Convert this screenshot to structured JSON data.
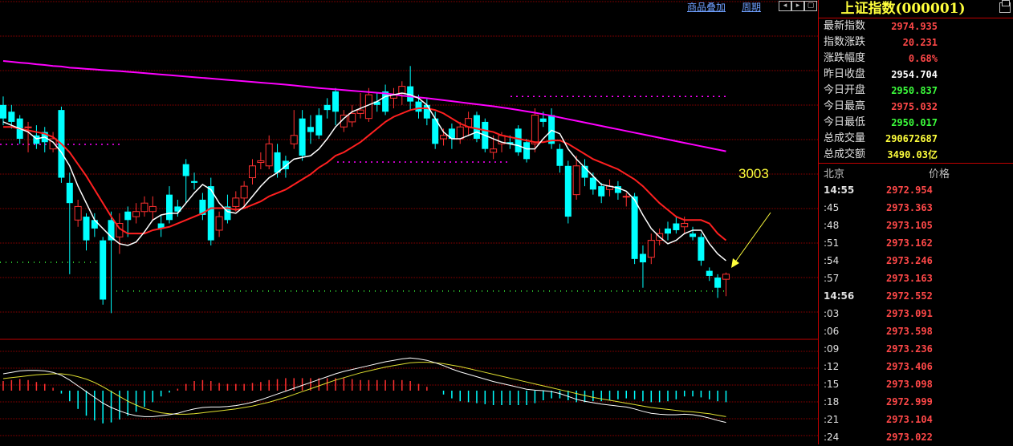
{
  "toolbar": {
    "overlay_label": "商品叠加",
    "period_label": "周期"
  },
  "annotation": {
    "text": "3003",
    "color": "#ffff3c"
  },
  "colors": {
    "up": "#ff3030",
    "down": "#00ffff",
    "ma5": "#ffffff",
    "ma10": "#ff2020",
    "ma60": "#ff00ff",
    "grid": "#8b0000",
    "arrow": "#ffff3c"
  },
  "panel": {
    "title": "上证指数(000001)",
    "stats": [
      {
        "label": "最新指数",
        "value": "2974.935",
        "color": "#ff4848"
      },
      {
        "label": "指数涨跌",
        "value": "20.231",
        "color": "#ff4848"
      },
      {
        "label": "涨跌幅度",
        "value": "0.68%",
        "color": "#ff4848"
      },
      {
        "label": "昨日收盘",
        "value": "2954.704",
        "color": "#ffffff"
      },
      {
        "label": "今日开盘",
        "value": "2950.837",
        "color": "#3cff3c"
      },
      {
        "label": "今日最高",
        "value": "2975.032",
        "color": "#ff4848"
      },
      {
        "label": "今日最低",
        "value": "2950.017",
        "color": "#3cff3c"
      },
      {
        "label": "总成交量",
        "value": "290672687",
        "color": "#ffff3c"
      },
      {
        "label": "总成交额",
        "value": "3490.03亿",
        "color": "#ffff3c"
      }
    ],
    "ticks_header": {
      "left": "北京",
      "right": "价格"
    },
    "ticks": [
      {
        "time": "14:55",
        "price": "2972.954",
        "bold": true
      },
      {
        "time": ":45",
        "price": "2973.363"
      },
      {
        "time": ":48",
        "price": "2973.105"
      },
      {
        "time": ":51",
        "price": "2973.162"
      },
      {
        "time": ":54",
        "price": "2973.246"
      },
      {
        "time": ":57",
        "price": "2973.163"
      },
      {
        "time": "14:56",
        "price": "2972.552",
        "bold": true
      },
      {
        "time": ":03",
        "price": "2973.091"
      },
      {
        "time": ":06",
        "price": "2973.598"
      },
      {
        "time": ":09",
        "price": "2973.236"
      },
      {
        "time": ":12",
        "price": "2973.406"
      },
      {
        "time": ":15",
        "price": "2973.098"
      },
      {
        "time": ":18",
        "price": "2972.999"
      },
      {
        "time": ":21",
        "price": "2973.104"
      },
      {
        "time": ":24",
        "price": "2973.022"
      }
    ]
  },
  "chart_data": {
    "type": "candlestick",
    "price_ylim": [
      2860,
      3060
    ],
    "ref_levels": {
      "upper": 3003,
      "lower": 2888,
      "left_dotted": 2905
    },
    "candles": [
      [
        2998,
        2990,
        3003,
        2986
      ],
      [
        2994,
        2988,
        2998,
        2984
      ],
      [
        2990,
        2978,
        2992,
        2975
      ],
      [
        2985,
        2985,
        2988,
        2970
      ],
      [
        2980,
        2975,
        2986,
        2972
      ],
      [
        2982,
        2976,
        2985,
        2970
      ],
      [
        2972,
        2978,
        2982,
        2970
      ],
      [
        2995,
        2955,
        2997,
        2952
      ],
      [
        2952,
        2940,
        2958,
        2898
      ],
      [
        2930,
        2938,
        2942,
        2926
      ],
      [
        2932,
        2918,
        2934,
        2912
      ],
      [
        2930,
        2925,
        2934,
        2920
      ],
      [
        2918,
        2883,
        2920,
        2880
      ],
      [
        2930,
        2918,
        2935,
        2875
      ],
      [
        2920,
        2928,
        2934,
        2910
      ],
      [
        2935,
        2930,
        2938,
        2920
      ],
      [
        2932,
        2935,
        2940,
        2928
      ],
      [
        2935,
        2940,
        2944,
        2932
      ],
      [
        2935,
        2938,
        2944,
        2930
      ],
      [
        2928,
        2925,
        2933,
        2920
      ],
      [
        2945,
        2930,
        2950,
        2928
      ],
      [
        2938,
        2935,
        2942,
        2932
      ],
      [
        2963,
        2956,
        2966,
        2940
      ],
      [
        2953,
        2952,
        2958,
        2948
      ],
      [
        2942,
        2933,
        2946,
        2930
      ],
      [
        2950,
        2918,
        2955,
        2915
      ],
      [
        2924,
        2932,
        2935,
        2920
      ],
      [
        2938,
        2930,
        2945,
        2928
      ],
      [
        2938,
        2943,
        2947,
        2935
      ],
      [
        2943,
        2950,
        2953,
        2938
      ],
      [
        2955,
        2962,
        2966,
        2951
      ],
      [
        2964,
        2965,
        2970,
        2960
      ],
      [
        2962,
        2975,
        2980,
        2960
      ],
      [
        2970,
        2958,
        2975,
        2955
      ],
      [
        2965,
        2960,
        2968,
        2955
      ],
      [
        2975,
        2980,
        2995,
        2972
      ],
      [
        2990,
        2968,
        2995,
        2965
      ],
      [
        2985,
        2982,
        2992,
        2975
      ],
      [
        2992,
        2980,
        2996,
        2978
      ],
      [
        2998,
        2995,
        3002,
        2990
      ],
      [
        3006,
        2994,
        3008,
        2986
      ],
      [
        2985,
        2992,
        2995,
        2982
      ],
      [
        2988,
        2993,
        2998,
        2985
      ],
      [
        2993,
        2995,
        3005,
        2990
      ],
      [
        2990,
        3004,
        3008,
        2988
      ],
      [
        3000,
        2998,
        3005,
        2994
      ],
      [
        3006,
        2994,
        3010,
        2992
      ],
      [
        3002,
        3004,
        3008,
        2996
      ],
      [
        3005,
        3009,
        3012,
        2998
      ],
      [
        3009,
        3000,
        3021,
        2995
      ],
      [
        3000,
        2994,
        3004,
        2990
      ],
      [
        2998,
        2990,
        3002,
        2986
      ],
      [
        2990,
        2975,
        2994,
        2972
      ],
      [
        2978,
        2980,
        2984,
        2974
      ],
      [
        2984,
        2978,
        2987,
        2972
      ],
      [
        2978,
        2985,
        2988,
        2975
      ],
      [
        2985,
        2990,
        2994,
        2980
      ],
      [
        2992,
        2978,
        2994,
        2976
      ],
      [
        2988,
        2972,
        2990,
        2970
      ],
      [
        2970,
        2972,
        2980,
        2966
      ],
      [
        2975,
        2980,
        2982,
        2970
      ],
      [
        2976,
        2975,
        2980,
        2972
      ],
      [
        2984,
        2970,
        2986,
        2968
      ],
      [
        2976,
        2966,
        2978,
        2964
      ],
      [
        2975,
        2992,
        2996,
        2970
      ],
      [
        2990,
        2988,
        2994,
        2985
      ],
      [
        2992,
        2975,
        2996,
        2972
      ],
      [
        2972,
        2962,
        2975,
        2958
      ],
      [
        2962,
        2932,
        2965,
        2928
      ],
      [
        2945,
        2962,
        2968,
        2942
      ],
      [
        2962,
        2955,
        2966,
        2950
      ],
      [
        2955,
        2948,
        2958,
        2945
      ],
      [
        2950,
        2944,
        2952,
        2940
      ],
      [
        2948,
        2950,
        2954,
        2944
      ],
      [
        2950,
        2946,
        2953,
        2942
      ],
      [
        2944,
        2944,
        2946,
        2938
      ],
      [
        2944,
        2907,
        2946,
        2904
      ],
      [
        2910,
        2905,
        2915,
        2890
      ],
      [
        2908,
        2918,
        2922,
        2904
      ],
      [
        2918,
        2922,
        2925,
        2915
      ],
      [
        2925,
        2922,
        2929,
        2918
      ],
      [
        2928,
        2924,
        2932,
        2922
      ],
      [
        2926,
        2928,
        2932,
        2922
      ],
      [
        2922,
        2920,
        2926,
        2918
      ],
      [
        2920,
        2906,
        2922,
        2903
      ],
      [
        2900,
        2897,
        2902,
        2894
      ],
      [
        2896,
        2890,
        2898,
        2884
      ],
      [
        2895,
        2898,
        2899,
        2885
      ]
    ],
    "ma5": [
      2988,
      2986,
      2984,
      2982,
      2978,
      2979,
      2976,
      2970,
      2962,
      2950,
      2940,
      2930,
      2925,
      2920,
      2916,
      2915,
      2917,
      2923,
      2930,
      2933,
      2934,
      2934,
      2940,
      2946,
      2951,
      2948,
      2940,
      2935,
      2934,
      2938,
      2944,
      2950,
      2955,
      2958,
      2962,
      2966,
      2967,
      2968,
      2972,
      2978,
      2985,
      2990,
      2994,
      2996,
      2998,
      3000,
      3003,
      3004,
      3005,
      3004,
      3002,
      2998,
      2990,
      2982,
      2978,
      2978,
      2980,
      2982,
      2980,
      2978,
      2976,
      2975,
      2974,
      2972,
      2972,
      2978,
      2983,
      2981,
      2972,
      2966,
      2961,
      2956,
      2951,
      2950,
      2949,
      2947,
      2942,
      2933,
      2925,
      2920,
      2916,
      2918,
      2922,
      2924,
      2924,
      2916,
      2910,
      2906
    ],
    "ma10": [
      2985,
      2985,
      2984,
      2983,
      2982,
      2981,
      2979,
      2975,
      2970,
      2963,
      2956,
      2948,
      2940,
      2932,
      2925,
      2922,
      2922,
      2922,
      2924,
      2925,
      2926,
      2928,
      2930,
      2932,
      2934,
      2937,
      2937,
      2937,
      2936,
      2937,
      2939,
      2941,
      2944,
      2946,
      2948,
      2951,
      2954,
      2957,
      2961,
      2964,
      2968,
      2970,
      2973,
      2976,
      2980,
      2984,
      2988,
      2991,
      2993,
      2995,
      2996,
      2996,
      2995,
      2993,
      2990,
      2987,
      2985,
      2984,
      2983,
      2982,
      2980,
      2979,
      2978,
      2977,
      2976,
      2976,
      2977,
      2977,
      2975,
      2972,
      2969,
      2966,
      2964,
      2962,
      2960,
      2957,
      2954,
      2950,
      2945,
      2940,
      2936,
      2932,
      2930,
      2930,
      2930,
      2928,
      2922,
      2918
    ],
    "ma60": [
      3024,
      3023.5,
      3023,
      3022.6,
      3022,
      3021.6,
      3021,
      3020.7,
      3020,
      3019.7,
      3019.3,
      3019,
      3018.6,
      3018.3,
      3018,
      3017.6,
      3017.2,
      3016.8,
      3016.4,
      3016,
      3015.6,
      3015.2,
      3014.8,
      3014.4,
      3014,
      3013.6,
      3013.2,
      3012.8,
      3012.4,
      3012,
      3011.6,
      3011.2,
      3010.8,
      3010.4,
      3010,
      3009.5,
      3009,
      3008.5,
      3008,
      3007.6,
      3007.2,
      3006.8,
      3006.4,
      3006,
      3005.6,
      3005.2,
      3004.8,
      3004.2,
      3003.5,
      3003,
      3002.5,
      3002,
      3001.4,
      3000.8,
      3000.2,
      2999.6,
      2999,
      2998.4,
      2997.8,
      2997.2,
      2996.5,
      2995.8,
      2995,
      2994.2,
      2993.4,
      2992.5,
      2991.6,
      2990.6,
      2989.6,
      2988.6,
      2987.6,
      2986.6,
      2985.6,
      2984.6,
      2983.6,
      2982.6,
      2981.6,
      2980.6,
      2979.6,
      2978.6,
      2977.6,
      2976.6,
      2975.6,
      2974.6,
      2973.6,
      2972.6,
      2971.6,
      2970.6
    ],
    "macd_ylim": [
      -1,
      1
    ],
    "dif": [
      0.35,
      0.38,
      0.41,
      0.42,
      0.42,
      0.41,
      0.38,
      0.32,
      0.22,
      0.1,
      -0.02,
      -0.14,
      -0.26,
      -0.35,
      -0.42,
      -0.48,
      -0.52,
      -0.54,
      -0.54,
      -0.52,
      -0.5,
      -0.47,
      -0.42,
      -0.38,
      -0.35,
      -0.34,
      -0.34,
      -0.33,
      -0.31,
      -0.28,
      -0.24,
      -0.19,
      -0.13,
      -0.07,
      -0.01,
      0.05,
      0.11,
      0.17,
      0.23,
      0.29,
      0.35,
      0.4,
      0.44,
      0.48,
      0.52,
      0.56,
      0.6,
      0.63,
      0.66,
      0.68,
      0.66,
      0.63,
      0.58,
      0.52,
      0.45,
      0.39,
      0.34,
      0.29,
      0.24,
      0.19,
      0.15,
      0.11,
      0.07,
      0.03,
      0.01,
      0.0,
      -0.02,
      -0.06,
      -0.12,
      -0.18,
      -0.22,
      -0.25,
      -0.28,
      -0.3,
      -0.32,
      -0.34,
      -0.38,
      -0.43,
      -0.47,
      -0.49,
      -0.5,
      -0.5,
      -0.49,
      -0.5,
      -0.53,
      -0.57,
      -0.62,
      -0.66
    ],
    "dea": [
      0.25,
      0.27,
      0.29,
      0.31,
      0.33,
      0.34,
      0.35,
      0.35,
      0.33,
      0.29,
      0.24,
      0.17,
      0.08,
      -0.02,
      -0.12,
      -0.22,
      -0.3,
      -0.37,
      -0.42,
      -0.46,
      -0.48,
      -0.49,
      -0.49,
      -0.48,
      -0.46,
      -0.44,
      -0.42,
      -0.4,
      -0.38,
      -0.35,
      -0.32,
      -0.28,
      -0.24,
      -0.19,
      -0.14,
      -0.08,
      -0.02,
      0.04,
      0.1,
      0.16,
      0.22,
      0.27,
      0.32,
      0.37,
      0.41,
      0.45,
      0.49,
      0.52,
      0.55,
      0.58,
      0.59,
      0.59,
      0.58,
      0.56,
      0.53,
      0.5,
      0.46,
      0.42,
      0.38,
      0.34,
      0.3,
      0.26,
      0.22,
      0.18,
      0.14,
      0.1,
      0.06,
      0.02,
      -0.02,
      -0.06,
      -0.1,
      -0.14,
      -0.17,
      -0.2,
      -0.23,
      -0.26,
      -0.29,
      -0.32,
      -0.35,
      -0.37,
      -0.39,
      -0.41,
      -0.43,
      -0.44,
      -0.46,
      -0.48,
      -0.51,
      -0.54
    ],
    "hist": [
      0.2,
      0.22,
      0.24,
      0.22,
      0.18,
      0.14,
      0.06,
      -0.06,
      -0.22,
      -0.38,
      -0.52,
      -0.62,
      -0.68,
      -0.66,
      -0.6,
      -0.52,
      -0.44,
      -0.34,
      -0.24,
      -0.12,
      -0.04,
      0.04,
      0.14,
      0.2,
      0.22,
      0.2,
      0.16,
      0.14,
      0.14,
      0.14,
      0.16,
      0.18,
      0.22,
      0.24,
      0.26,
      0.26,
      0.26,
      0.26,
      0.26,
      0.26,
      0.26,
      0.26,
      0.24,
      0.22,
      0.22,
      0.22,
      0.22,
      0.22,
      0.22,
      0.2,
      0.14,
      0.08,
      0.0,
      -0.08,
      -0.16,
      -0.22,
      -0.24,
      -0.26,
      -0.28,
      -0.3,
      -0.3,
      -0.3,
      -0.3,
      -0.3,
      -0.26,
      -0.2,
      -0.16,
      -0.16,
      -0.2,
      -0.24,
      -0.24,
      -0.22,
      -0.22,
      -0.2,
      -0.18,
      -0.16,
      -0.18,
      -0.22,
      -0.24,
      -0.24,
      -0.22,
      -0.18,
      -0.12,
      -0.12,
      -0.14,
      -0.18,
      -0.22,
      -0.24
    ]
  }
}
